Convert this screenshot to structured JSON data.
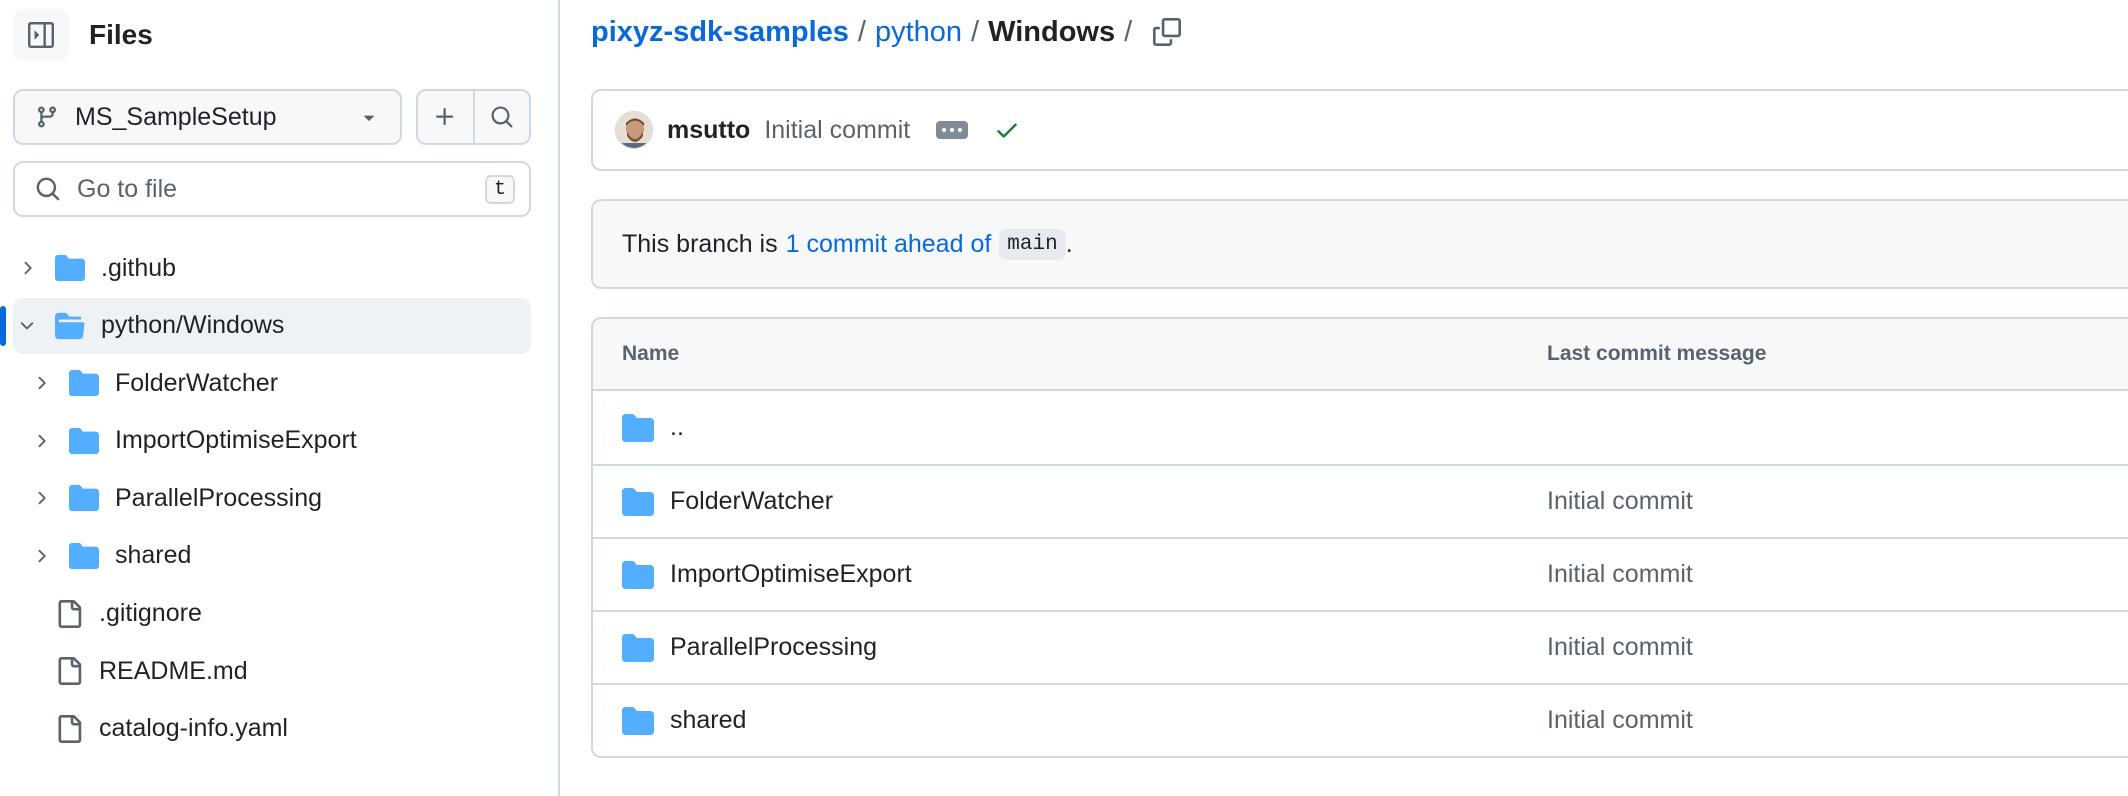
{
  "sidebar": {
    "title": "Files",
    "branch": "MS_SampleSetup",
    "search_placeholder": "Go to file",
    "search_shortcut": "t",
    "tree": [
      {
        "label": ".github",
        "type": "folder",
        "level": 0,
        "expanded": false
      },
      {
        "label": "python/Windows",
        "type": "folder",
        "level": 0,
        "expanded": true,
        "active": true
      },
      {
        "label": "FolderWatcher",
        "type": "folder",
        "level": 1,
        "expanded": false
      },
      {
        "label": "ImportOptimiseExport",
        "type": "folder",
        "level": 1,
        "expanded": false
      },
      {
        "label": "ParallelProcessing",
        "type": "folder",
        "level": 1,
        "expanded": false
      },
      {
        "label": "shared",
        "type": "folder",
        "level": 1,
        "expanded": false
      },
      {
        "label": ".gitignore",
        "type": "file",
        "level": 0
      },
      {
        "label": "README.md",
        "type": "file",
        "level": 0
      },
      {
        "label": "catalog-info.yaml",
        "type": "file",
        "level": 0
      }
    ]
  },
  "breadcrumb": {
    "repo": "pixyz-sdk-samples",
    "folder": "python",
    "current": "Windows",
    "separator": "/"
  },
  "commit": {
    "author": "msutto",
    "message": "Initial commit"
  },
  "banner": {
    "prefix": "This branch is",
    "link": "1 commit ahead of",
    "base_branch": "main",
    "suffix": "."
  },
  "table": {
    "headers": {
      "name": "Name",
      "message": "Last commit message"
    },
    "rows": [
      {
        "name": "..",
        "message": ""
      },
      {
        "name": "FolderWatcher",
        "message": "Initial commit"
      },
      {
        "name": "ImportOptimiseExport",
        "message": "Initial commit"
      },
      {
        "name": "ParallelProcessing",
        "message": "Initial commit"
      },
      {
        "name": "shared",
        "message": "Initial commit"
      }
    ]
  },
  "colors": {
    "link": "#0969da",
    "folder": "#54aeff",
    "success": "#1a7f37",
    "border": "#d1d9e0",
    "muted": "#59636e"
  },
  "icons": {
    "panel": "sidebar-collapse-icon",
    "branch": "git-branch-icon",
    "dropdown": "triangle-down-icon",
    "add": "plus-icon",
    "search": "search-icon",
    "folder": "folder-icon",
    "folder_open": "folder-open-icon",
    "file": "file-icon",
    "copy": "copy-icon",
    "check": "check-icon",
    "ellipsis": "kebab-horizontal-icon"
  }
}
